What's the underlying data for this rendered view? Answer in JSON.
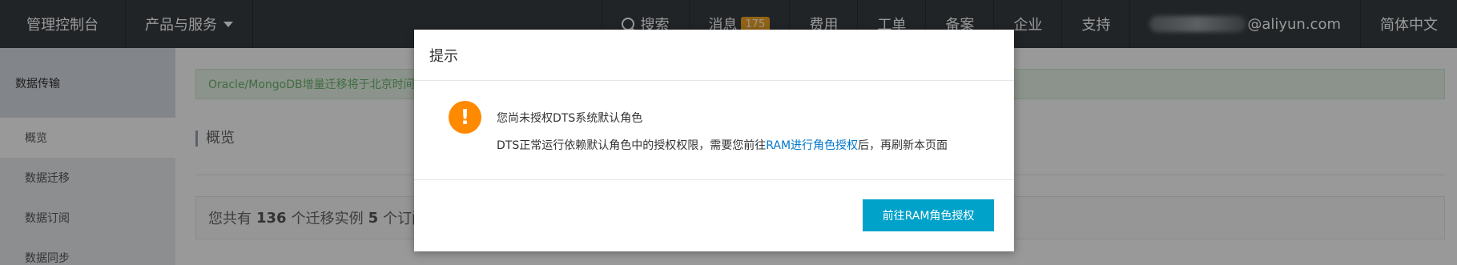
{
  "topbar": {
    "console": "管理控制台",
    "products": "产品与服务",
    "search": "搜索",
    "messages": "消息",
    "messages_count": "175",
    "billing": "费用",
    "tickets": "工单",
    "icp": "备案",
    "enterprise": "企业",
    "support": "支持",
    "account_suffix": "@aliyun.com",
    "language": "简体中文"
  },
  "sidebar": {
    "title": "数据传输",
    "items": [
      {
        "label": "概览"
      },
      {
        "label": "数据迁移"
      },
      {
        "label": "数据订阅"
      },
      {
        "label": "数据同步"
      }
    ]
  },
  "main": {
    "notice": "Oracle/MongoDB增量迁移将于北京时间",
    "overview_title": "概览",
    "summary_prefix": "您共有",
    "migrations_count": "136",
    "summary_mid": "个迁移实例",
    "subscriptions_count": "5",
    "summary_suffix": "个订阅"
  },
  "modal": {
    "title": "提示",
    "message_title": "您尚未授权DTS系统默认角色",
    "detail_before": "DTS正常运行依赖默认角色中的授权权限，需要您前往",
    "detail_link": "RAM进行角色授权",
    "detail_after": "后，再刷新本页面",
    "primary_button": "前往RAM角色授权"
  },
  "colors": {
    "topbar": "#373d41",
    "badge": "#f5a623",
    "warn": "#ff8a00",
    "primary": "#00a2ca",
    "link": "#0077cc"
  }
}
